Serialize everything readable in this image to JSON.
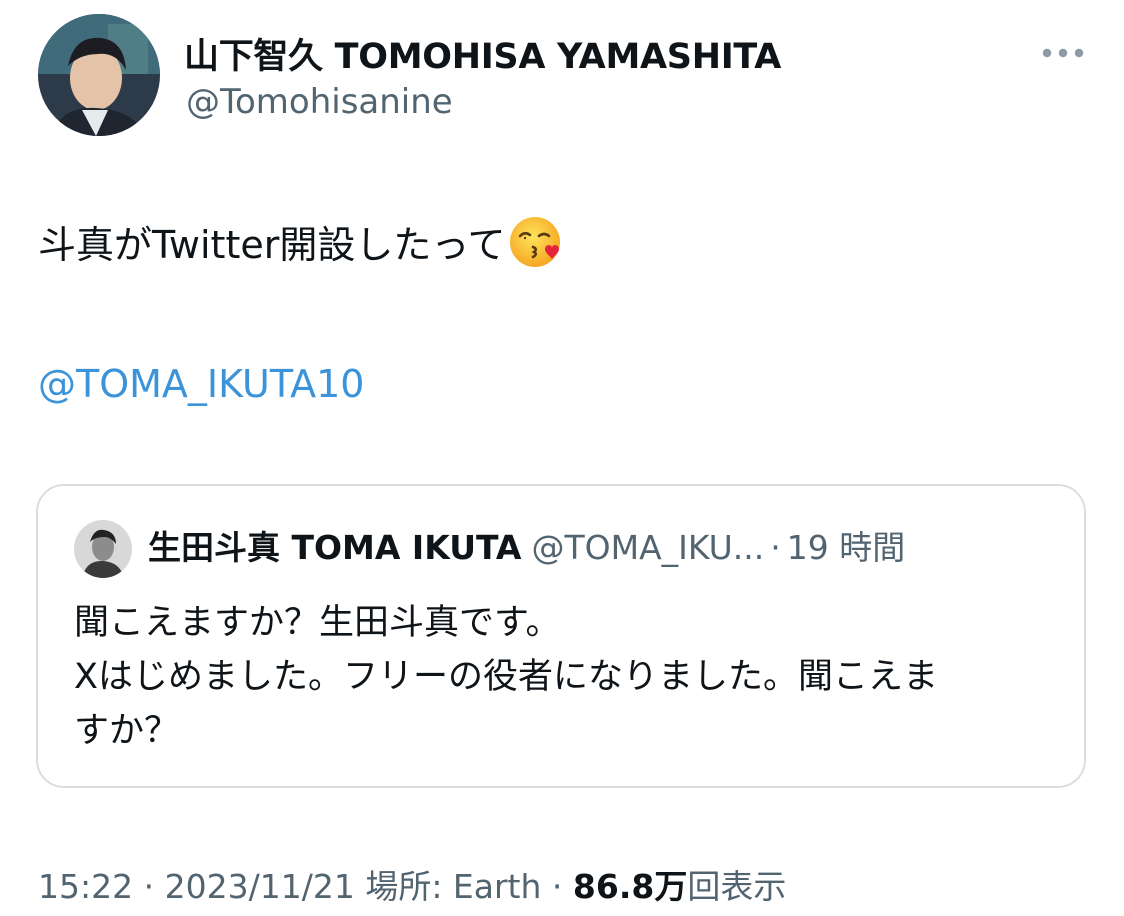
{
  "author": {
    "display_name": "山下智久 TOMOHISA YAMASHITA",
    "handle": "@Tomohisanine"
  },
  "tweet": {
    "text": "斗真がTwitter開設したって",
    "emoji": "kissing-face-with-heart-emoji",
    "mention": "@TOMA_IKUTA10"
  },
  "quoted_tweet": {
    "display_name": "生田斗真 TOMA IKUTA",
    "handle": "@TOMA_IKU...",
    "separator": "·",
    "time": "19 時間",
    "lines": [
      "聞こえますか？生田斗真です。",
      "Xはじめました。フリーの役者になりました。聞こえま",
      "すか？"
    ]
  },
  "meta": {
    "time": "15:22",
    "date": "2023/11/21",
    "location": "場所: Earth",
    "views_count": "86.8万",
    "views_label": "回表示",
    "separator": "·"
  },
  "icons": {
    "more": "more-horizontal-icon"
  },
  "colors": {
    "link": "#3b93d9",
    "secondary_text": "#536471",
    "border": "#d9dee3"
  }
}
